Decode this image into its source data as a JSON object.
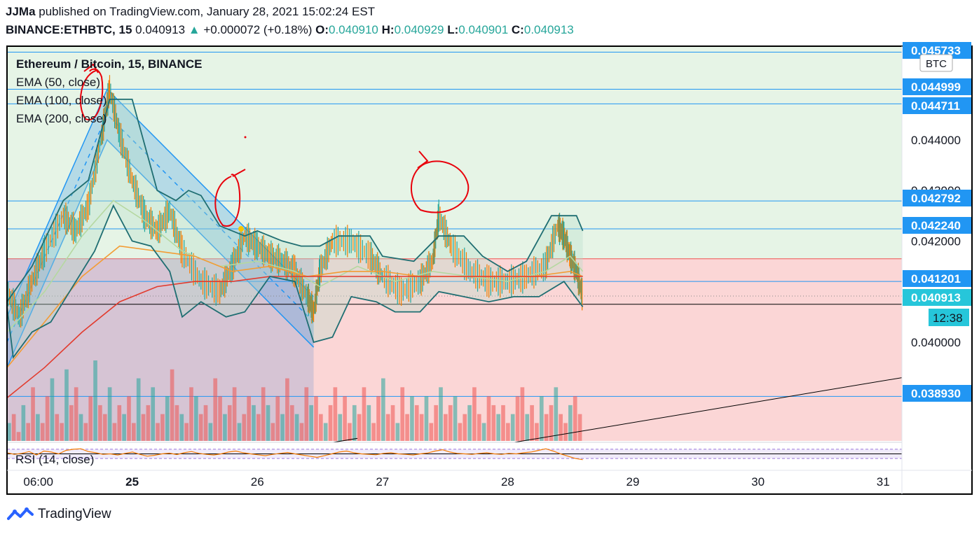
{
  "header": {
    "author": "JJMa",
    "published_text": "published on TradingView.com, January 28, 2021 15:02:24 EST",
    "symbol": "BINANCE:ETHBTC, 15",
    "last": "0.040913",
    "change_arrow": "▲",
    "change": "+0.000072 (+0.18%)",
    "o_label": "O:",
    "o": "0.040910",
    "h_label": "H:",
    "h": "0.040929",
    "l_label": "L:",
    "l": "0.040901",
    "c_label": "C:",
    "c": "0.040913"
  },
  "colors": {
    "up": "#26a69a",
    "down": "#ef5350",
    "label_blue": "#2196f3",
    "green_zone": "#e6f4e6",
    "red_zone": "#fbd6d6",
    "channel": "#2196f3",
    "bollinger": "#1f6e72",
    "ema50": "#b5d8a0",
    "ema100": "#f39c34",
    "ema200": "#e23b2e",
    "rsi_line": "#f57c00",
    "annotation": "#e8000b"
  },
  "legend": {
    "title": "Ethereum / Bitcoin, 15, BINANCE",
    "ema50": "EMA (50, close)",
    "ema100": "EMA (100, close)",
    "ema200": "EMA (200, close)"
  },
  "rsi_label": "RSI (14, close)",
  "currency_badge": "BTC",
  "price_labels": [
    "0.045733",
    "0.044999",
    "0.044711",
    "0.042792",
    "0.042240",
    "0.041201",
    "0.040913",
    "0.038930"
  ],
  "countdown": "12:38",
  "footer": {
    "brand": "TradingView"
  },
  "chart_data": {
    "type": "line",
    "title": "Ethereum / Bitcoin, 15, BINANCE",
    "x_ticks": [
      {
        "label": "06:00",
        "day": 24.25
      },
      {
        "label": "25",
        "day": 25
      },
      {
        "label": "26",
        "day": 26
      },
      {
        "label": "27",
        "day": 27
      },
      {
        "label": "28",
        "day": 28
      },
      {
        "label": "29",
        "day": 29
      },
      {
        "label": "30",
        "day": 30
      },
      {
        "label": "31",
        "day": 31
      }
    ],
    "xlim": [
      24.0,
      31.15
    ],
    "y_ticks": [
      "0.044000",
      "0.043000",
      "0.042000",
      "0.040000"
    ],
    "y_tick_values": [
      0.044,
      0.043,
      0.042,
      0.04
    ],
    "ylim": [
      0.03805,
      0.04585
    ],
    "horizontal_levels": [
      0.045733,
      0.044999,
      0.044711,
      0.042792,
      0.04224,
      0.041201,
      0.03893
    ],
    "zone_boundary": 0.04165,
    "current_price": 0.040913,
    "support_line": 0.04075,
    "price_path": [
      [
        24.0,
        0.041
      ],
      [
        24.1,
        0.0405
      ],
      [
        24.2,
        0.0412
      ],
      [
        24.3,
        0.0418
      ],
      [
        24.45,
        0.0425
      ],
      [
        24.55,
        0.0422
      ],
      [
        24.65,
        0.0427
      ],
      [
        24.75,
        0.044
      ],
      [
        24.82,
        0.045
      ],
      [
        24.9,
        0.0441
      ],
      [
        25.0,
        0.0432
      ],
      [
        25.1,
        0.0425
      ],
      [
        25.2,
        0.0422
      ],
      [
        25.3,
        0.0426
      ],
      [
        25.4,
        0.0418
      ],
      [
        25.55,
        0.0412
      ],
      [
        25.7,
        0.041
      ],
      [
        25.8,
        0.0415
      ],
      [
        25.9,
        0.0421
      ],
      [
        26.0,
        0.0419
      ],
      [
        26.1,
        0.0417
      ],
      [
        26.2,
        0.0416
      ],
      [
        26.3,
        0.0414
      ],
      [
        26.4,
        0.0409
      ],
      [
        26.45,
        0.0406
      ],
      [
        26.5,
        0.0414
      ],
      [
        26.6,
        0.042
      ],
      [
        26.75,
        0.042
      ],
      [
        26.9,
        0.0417
      ],
      [
        27.0,
        0.0413
      ],
      [
        27.15,
        0.041
      ],
      [
        27.3,
        0.0412
      ],
      [
        27.4,
        0.0416
      ],
      [
        27.45,
        0.0425
      ],
      [
        27.55,
        0.0419
      ],
      [
        27.7,
        0.0414
      ],
      [
        27.85,
        0.0412
      ],
      [
        28.0,
        0.0412
      ],
      [
        28.15,
        0.0413
      ],
      [
        28.3,
        0.0415
      ],
      [
        28.4,
        0.0423
      ],
      [
        28.45,
        0.0421
      ],
      [
        28.5,
        0.0417
      ],
      [
        28.55,
        0.0414
      ],
      [
        28.6,
        0.0409
      ]
    ],
    "bollinger_upper": [
      [
        24.0,
        0.0408
      ],
      [
        24.2,
        0.0415
      ],
      [
        24.45,
        0.0428
      ],
      [
        24.65,
        0.0432
      ],
      [
        24.82,
        0.0448
      ],
      [
        25.0,
        0.0448
      ],
      [
        25.2,
        0.043
      ],
      [
        25.35,
        0.0428
      ],
      [
        25.45,
        0.043
      ],
      [
        25.55,
        0.0429
      ],
      [
        25.7,
        0.0423
      ],
      [
        25.9,
        0.0421
      ],
      [
        26.0,
        0.0422
      ],
      [
        26.2,
        0.042
      ],
      [
        26.35,
        0.0419
      ],
      [
        26.5,
        0.0419
      ],
      [
        26.65,
        0.0421
      ],
      [
        26.9,
        0.0421
      ],
      [
        27.0,
        0.0417
      ],
      [
        27.25,
        0.0416
      ],
      [
        27.45,
        0.0421
      ],
      [
        27.65,
        0.0421
      ],
      [
        27.8,
        0.0417
      ],
      [
        28.0,
        0.0414
      ],
      [
        28.15,
        0.0416
      ],
      [
        28.35,
        0.0425
      ],
      [
        28.55,
        0.0425
      ],
      [
        28.6,
        0.0422
      ]
    ],
    "bollinger_lower": [
      [
        24.0,
        0.0407
      ],
      [
        24.05,
        0.0397
      ],
      [
        24.2,
        0.0402
      ],
      [
        24.35,
        0.0404
      ],
      [
        24.55,
        0.0412
      ],
      [
        24.7,
        0.0418
      ],
      [
        24.85,
        0.0427
      ],
      [
        25.0,
        0.042
      ],
      [
        25.15,
        0.0419
      ],
      [
        25.3,
        0.0414
      ],
      [
        25.4,
        0.0405
      ],
      [
        25.55,
        0.0408
      ],
      [
        25.75,
        0.0405
      ],
      [
        25.9,
        0.0406
      ],
      [
        26.1,
        0.0413
      ],
      [
        26.3,
        0.0412
      ],
      [
        26.45,
        0.04
      ],
      [
        26.6,
        0.0401
      ],
      [
        26.75,
        0.0409
      ],
      [
        26.95,
        0.0408
      ],
      [
        27.1,
        0.0406
      ],
      [
        27.3,
        0.0406
      ],
      [
        27.45,
        0.041
      ],
      [
        27.65,
        0.0409
      ],
      [
        27.85,
        0.0408
      ],
      [
        28.05,
        0.0409
      ],
      [
        28.25,
        0.0409
      ],
      [
        28.45,
        0.0412
      ],
      [
        28.6,
        0.0407
      ]
    ],
    "ema50": [
      [
        24.0,
        0.0402
      ],
      [
        24.3,
        0.041
      ],
      [
        24.6,
        0.0421
      ],
      [
        24.85,
        0.0428
      ],
      [
        25.1,
        0.0424
      ],
      [
        25.4,
        0.0418
      ],
      [
        25.7,
        0.0415
      ],
      [
        26.0,
        0.0416
      ],
      [
        26.3,
        0.0414
      ],
      [
        26.5,
        0.0411
      ],
      [
        26.8,
        0.0415
      ],
      [
        27.1,
        0.0412
      ],
      [
        27.4,
        0.0414
      ],
      [
        27.7,
        0.0413
      ],
      [
        28.0,
        0.0412
      ],
      [
        28.3,
        0.0414
      ],
      [
        28.5,
        0.0417
      ],
      [
        28.6,
        0.0414
      ]
    ],
    "ema100": [
      [
        24.0,
        0.0395
      ],
      [
        24.3,
        0.0404
      ],
      [
        24.6,
        0.0413
      ],
      [
        24.9,
        0.0419
      ],
      [
        25.2,
        0.0418
      ],
      [
        25.5,
        0.0417
      ],
      [
        25.8,
        0.0414
      ],
      [
        26.1,
        0.0415
      ],
      [
        26.4,
        0.0413
      ],
      [
        26.7,
        0.0414
      ],
      [
        27.0,
        0.0414
      ],
      [
        27.3,
        0.0413
      ],
      [
        27.6,
        0.0413
      ],
      [
        27.9,
        0.0413
      ],
      [
        28.2,
        0.0413
      ],
      [
        28.5,
        0.0414
      ],
      [
        28.6,
        0.0413
      ]
    ],
    "ema200": [
      [
        24.0,
        0.0389
      ],
      [
        24.3,
        0.0395
      ],
      [
        24.6,
        0.0402
      ],
      [
        24.9,
        0.0408
      ],
      [
        25.2,
        0.0411
      ],
      [
        25.5,
        0.0412
      ],
      [
        25.8,
        0.0412
      ],
      [
        26.1,
        0.0413
      ],
      [
        26.4,
        0.0413
      ],
      [
        26.7,
        0.0413
      ],
      [
        27.0,
        0.0413
      ],
      [
        27.4,
        0.0413
      ],
      [
        27.8,
        0.0413
      ],
      [
        28.2,
        0.0413
      ],
      [
        28.6,
        0.0413
      ]
    ],
    "channel": {
      "upper": [
        [
          24.0,
          0.0405
        ],
        [
          24.8,
          0.045
        ],
        [
          26.45,
          0.0409
        ]
      ],
      "lower": [
        [
          24.0,
          0.0395
        ],
        [
          24.8,
          0.044
        ],
        [
          26.45,
          0.0399
        ]
      ],
      "mid_dashed": [
        [
          24.0,
          0.04
        ],
        [
          24.8,
          0.0445
        ],
        [
          26.45,
          0.0404
        ]
      ],
      "box": {
        "x0": 24.0,
        "x1": 26.45,
        "y_top": 0.04165
      }
    },
    "trend_lines": [
      [
        [
          26.55,
          0.038
        ],
        [
          26.8,
          0.0381
        ]
      ],
      [
        [
          28.0,
          0.038
        ],
        [
          31.15,
          0.0393
        ]
      ]
    ],
    "volume": {
      "x_start": 24.0,
      "x_end": 28.6,
      "bars": [
        2,
        3,
        1,
        4,
        2,
        6,
        3,
        2,
        5,
        7,
        3,
        2,
        8,
        4,
        6,
        3,
        2,
        5,
        9,
        4,
        3,
        6,
        2,
        4,
        3,
        5,
        2,
        7,
        3,
        4,
        6,
        2,
        3,
        5,
        8,
        4,
        3,
        2,
        6,
        5,
        3,
        4,
        2,
        7,
        5,
        3,
        4,
        6,
        2,
        3,
        5,
        4,
        3,
        6,
        4,
        2,
        5,
        3,
        7,
        4,
        3,
        2,
        6,
        4,
        5,
        3,
        2,
        4,
        6,
        3,
        5,
        2,
        4,
        3,
        6,
        4,
        2,
        5,
        7,
        3,
        4,
        2,
        6,
        3,
        5,
        4,
        3,
        5,
        2,
        4,
        6,
        3,
        4,
        5,
        2,
        3,
        4,
        6,
        3,
        2,
        5,
        4,
        3,
        4,
        2,
        3,
        5,
        6,
        3,
        4,
        2,
        5,
        3,
        4,
        6,
        3,
        2,
        4,
        5,
        3
      ]
    },
    "rsi": {
      "ylim": [
        0,
        100
      ],
      "bands": [
        30,
        70
      ],
      "values": [
        55,
        48,
        52,
        60,
        45,
        62,
        58,
        50,
        65,
        70,
        72,
        60,
        55,
        48,
        50,
        45,
        52,
        58,
        48,
        40,
        44,
        50,
        53,
        47,
        55,
        60,
        52,
        48,
        45,
        50,
        58,
        62,
        55,
        50,
        46,
        42,
        48,
        52,
        56,
        50,
        45,
        40,
        35,
        42,
        50,
        58,
        62,
        55,
        50,
        48,
        46,
        52,
        55,
        50,
        48,
        45,
        50,
        54,
        62,
        68,
        58,
        52,
        50,
        48,
        52,
        55,
        50,
        48,
        52,
        50,
        55,
        58,
        65,
        72,
        62,
        50,
        40,
        30,
        25
      ]
    }
  }
}
